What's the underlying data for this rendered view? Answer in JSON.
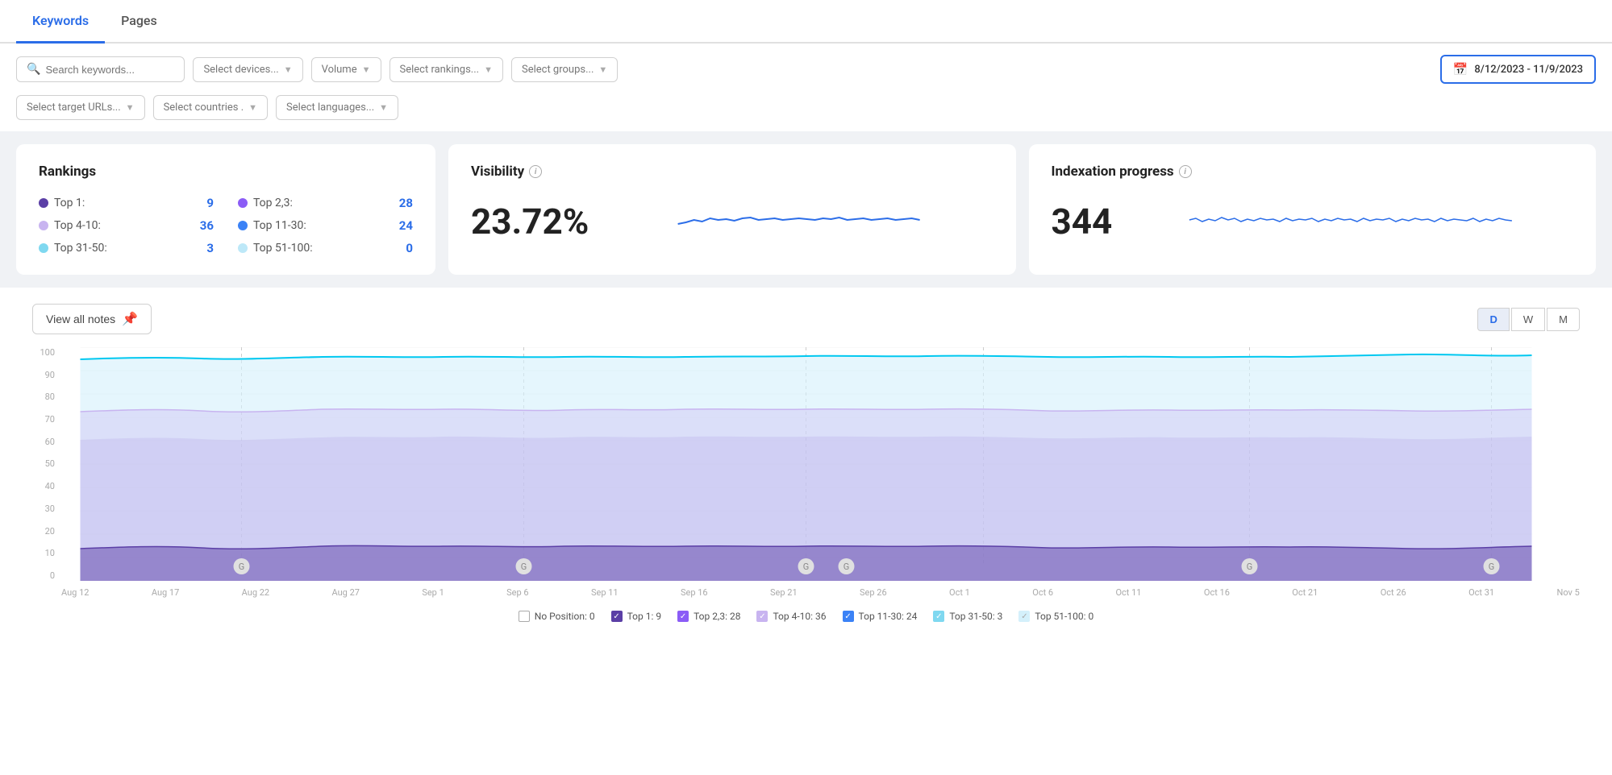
{
  "tabs": [
    {
      "id": "keywords",
      "label": "Keywords",
      "active": true
    },
    {
      "id": "pages",
      "label": "Pages",
      "active": false
    }
  ],
  "filters": {
    "search_placeholder": "Search keywords...",
    "devices_placeholder": "Select devices...",
    "volume_placeholder": "Volume",
    "rankings_placeholder": "Select rankings...",
    "groups_placeholder": "Select groups...",
    "date_range": "8/12/2023 - 11/9/2023",
    "target_urls_placeholder": "Select target URLs...",
    "countries_placeholder": "Select countries .",
    "languages_placeholder": "Select languages..."
  },
  "rankings": {
    "title": "Rankings",
    "items": [
      {
        "label": "Top 1:",
        "value": "9",
        "color": "#5b3fa6",
        "col": 1
      },
      {
        "label": "Top 4-10:",
        "value": "36",
        "color": "#c8b4f0",
        "col": 1
      },
      {
        "label": "Top 31-50:",
        "value": "3",
        "color": "#7fd8f0",
        "col": 1
      },
      {
        "label": "Top 2,3:",
        "value": "28",
        "color": "#8b5cf6",
        "col": 2
      },
      {
        "label": "Top 11-30:",
        "value": "24",
        "color": "#3b82f6",
        "col": 2
      },
      {
        "label": "Top 51-100:",
        "value": "0",
        "color": "#bde8f8",
        "col": 2
      }
    ]
  },
  "visibility": {
    "title": "Visibility",
    "value": "23.72%"
  },
  "indexation": {
    "title": "Indexation progress",
    "value": "344"
  },
  "chart": {
    "view_notes_label": "View all notes",
    "period_buttons": [
      "D",
      "W",
      "M"
    ],
    "active_period": "D",
    "y_labels": [
      "100",
      "90",
      "80",
      "70",
      "60",
      "50",
      "40",
      "30",
      "20",
      "10",
      "0"
    ],
    "x_labels": [
      "Aug 12",
      "Aug 17",
      "Aug 22",
      "Aug 27",
      "Sep 1",
      "Sep 6",
      "Sep 11",
      "Sep 16",
      "Sep 21",
      "Sep 26",
      "Oct 1",
      "Oct 6",
      "Oct 11",
      "Oct 16",
      "Oct 21",
      "Oct 26",
      "Oct 31",
      "Nov 5"
    ]
  },
  "legend": [
    {
      "label": "No Position: 0",
      "type": "checkbox",
      "checked": false,
      "color": "#fff",
      "border": "#aaa"
    },
    {
      "label": "Top 1: 9",
      "type": "checkbox",
      "checked": true,
      "color": "#5b3fa6"
    },
    {
      "label": "Top 2,3: 28",
      "type": "checkbox",
      "checked": true,
      "color": "#8b5cf6"
    },
    {
      "label": "Top 4-10: 36",
      "type": "checkbox",
      "checked": true,
      "color": "#c8b4f0"
    },
    {
      "label": "Top 11-30: 24",
      "type": "checkbox",
      "checked": true,
      "color": "#3b82f6"
    },
    {
      "label": "Top 31-50: 3",
      "type": "checkbox",
      "checked": true,
      "color": "#7fd8f0"
    },
    {
      "label": "Top 51-100: 0",
      "type": "checkbox",
      "checked": true,
      "color": "#d4f0fb"
    }
  ],
  "colors": {
    "accent": "#2b6de8",
    "top1": "#5b3fa6",
    "top23": "#8b5cf6",
    "top410": "#c8b4f0",
    "top1130": "#3b82f6",
    "top3150": "#7fd8f0",
    "top51100": "#d4f0fb"
  }
}
